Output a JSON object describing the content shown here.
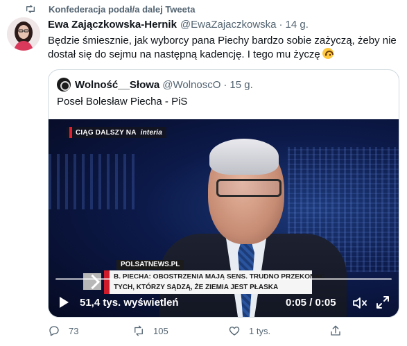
{
  "retweet": {
    "text": "Konfederacja podał/a dalej Tweeta",
    "icon": "retweet-icon"
  },
  "tweet": {
    "author_name": "Ewa Zajączkowska-Hernik",
    "handle": "@EwaZajaczkowska",
    "separator": "·",
    "time": "14 g.",
    "text": "Będzie śmiesznie, jak wyborcy pana Piechy bardzo sobie zażyczą, żeby nie dostał się do sejmu na następną kadencję. I tego mu życzę",
    "emoji": "upside-down-face-emoji"
  },
  "quote": {
    "author_name": "Wolność__Słowa",
    "handle": "@WolnoscO",
    "separator": "·",
    "time": "15 g.",
    "text": "Poseł Bolesław Piecha - PiS"
  },
  "video": {
    "banner_top": "CIĄG DALSZY NA",
    "banner_brand": "interia",
    "news_source": "POLSATNEWS.PL",
    "news_line1": "B. PIECHA: OBOSTRZENIA MAJĄ SENS. TRUDNO PRZEKONAĆ",
    "news_line2": "TYCH, KTÓRZY SĄDZĄ, ŻE ZIEMIA JEST PŁASKA",
    "views": "51,4 tys. wyświetleń",
    "timecode": "0:05 / 0:05"
  },
  "actions": {
    "reply_count": "73",
    "retweet_count": "105",
    "like_count": "1 tys.",
    "share_label": ""
  },
  "colors": {
    "text_primary": "#0f1419",
    "text_secondary": "#536471",
    "border": "#cfd9de",
    "breaking_red": "#d01c2a"
  }
}
